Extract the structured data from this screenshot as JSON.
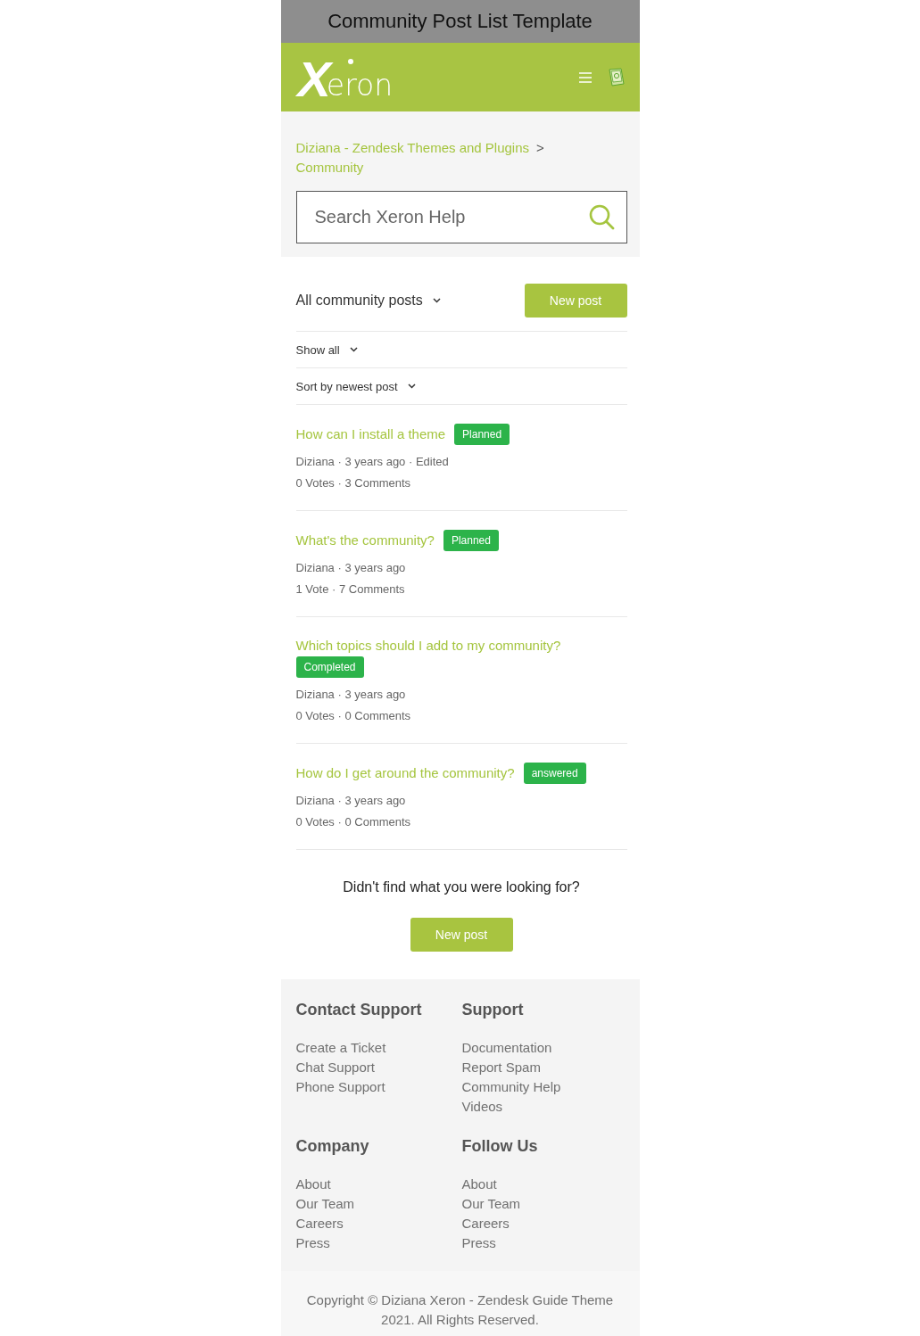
{
  "window": {
    "title": "Community Post List Template"
  },
  "header": {
    "logo": {
      "mark": "X",
      "text": "eron"
    }
  },
  "breadcrumb": {
    "items": [
      "Diziana - Zendesk Themes and Plugins",
      "Community"
    ],
    "separator": ">"
  },
  "search": {
    "placeholder": "Search Xeron Help"
  },
  "toolbar": {
    "filter": "All community posts",
    "new_post_button": "New post"
  },
  "filters": [
    "Show all",
    "Sort by newest post"
  ],
  "posts": [
    {
      "title": "How can I install a theme",
      "status": "Planned",
      "meta": "Diziana · 3 years ago · Edited",
      "stats": "0 Votes · 3 Comments"
    },
    {
      "title": "What's the community?",
      "status": "Planned",
      "meta": "Diziana · 3 years ago",
      "stats": "1 Vote · 7 Comments"
    },
    {
      "title": "Which topics should I add to my community?",
      "status": "Completed",
      "meta": "Diziana · 3 years ago",
      "stats": "0 Votes · 0 Comments"
    },
    {
      "title": "How do I get around the community?",
      "status": "answered",
      "meta": "Diziana · 3 years ago",
      "stats": "0 Votes · 0 Comments"
    }
  ],
  "prompt": {
    "text": "Didn't find what you were looking for?",
    "button": "New post"
  },
  "footer": {
    "columns": [
      {
        "heading": "Contact Support",
        "links": [
          "Create a Ticket",
          "Chat Support",
          "Phone Support"
        ]
      },
      {
        "heading": "Support",
        "links": [
          "Documentation",
          "Report Spam",
          "Community Help",
          "Videos"
        ]
      },
      {
        "heading": "Company",
        "links": [
          "About",
          "Our Team",
          "Careers",
          "Press"
        ]
      },
      {
        "heading": "Follow Us",
        "links": [
          "About",
          "Our Team",
          "Careers",
          "Press"
        ]
      }
    ],
    "copyright": "Copyright © Diziana Xeron - Zendesk Guide Theme 2021. All Rights Reserved."
  }
}
